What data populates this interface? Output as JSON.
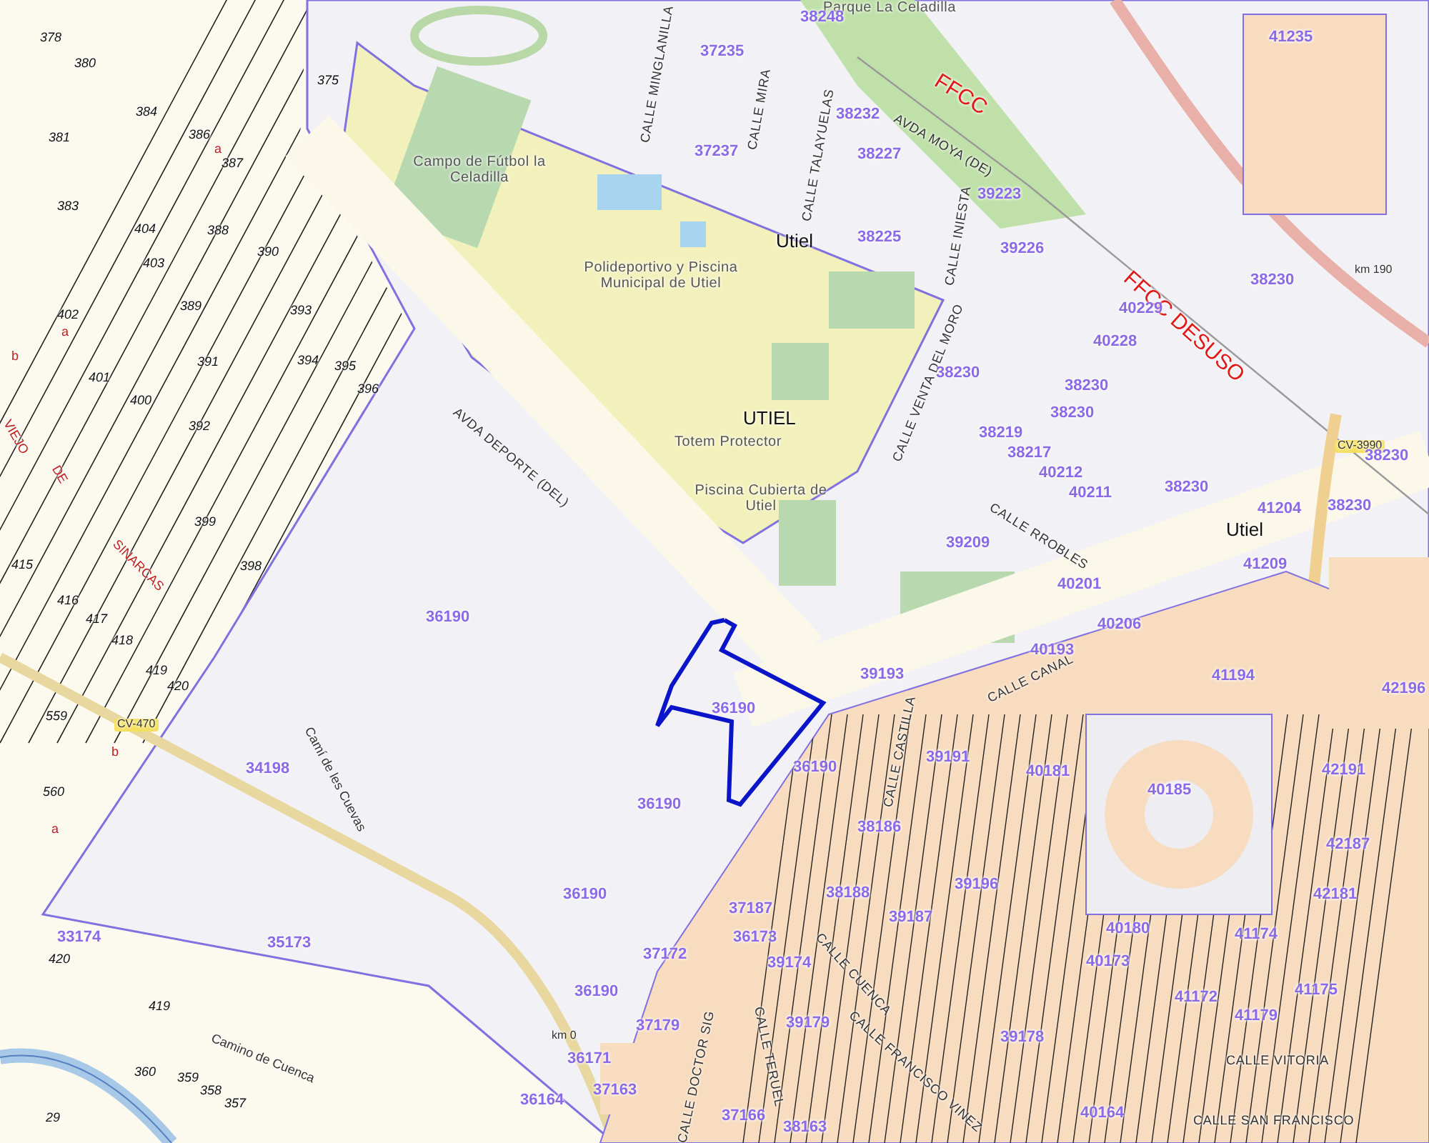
{
  "map": {
    "labels": [
      {
        "text": "Parque La Celadilla",
        "kind": "place"
      },
      {
        "text": "Campo de Fútbol la Celadilla",
        "kind": "place"
      },
      {
        "text": "Polideportivo y Piscina Municipal de Utiel",
        "kind": "place"
      },
      {
        "text": "Totem Protector",
        "kind": "place"
      },
      {
        "text": "Piscina Cubierta de Utiel",
        "kind": "place"
      },
      {
        "text": "Utiel",
        "kind": "town"
      },
      {
        "text": "UTIEL",
        "kind": "town"
      },
      {
        "text": "Utiel",
        "kind": "town"
      },
      {
        "text": "FFCC",
        "kind": "rail"
      },
      {
        "text": "FFCC DESUSO",
        "kind": "rail"
      },
      {
        "text": "CV-3990",
        "kind": "road_code"
      },
      {
        "text": "CV-470",
        "kind": "road_code"
      },
      {
        "text": "km 190",
        "kind": "km"
      },
      {
        "text": "km 0",
        "kind": "km"
      },
      {
        "text": "CALLE MINGLANILLA",
        "kind": "street"
      },
      {
        "text": "CALLE MIRA",
        "kind": "street"
      },
      {
        "text": "CALLE TALAYUELAS",
        "kind": "street"
      },
      {
        "text": "AVDA MOYA (DE)",
        "kind": "street"
      },
      {
        "text": "CALLE INIESTA",
        "kind": "street"
      },
      {
        "text": "CALLE VENTA DEL MORO",
        "kind": "street"
      },
      {
        "text": "CALLE RROBLES",
        "kind": "street"
      },
      {
        "text": "AVDA DEPORTE (DEL)",
        "kind": "street"
      },
      {
        "text": "CALLE CANAL",
        "kind": "street"
      },
      {
        "text": "CALLE CUENCA",
        "kind": "street"
      },
      {
        "text": "CALLE TERUEL",
        "kind": "street"
      },
      {
        "text": "CALLE FRANCISCO VINEZ",
        "kind": "street"
      },
      {
        "text": "CALLE VITORIA",
        "kind": "street"
      },
      {
        "text": "CALLE SAN FRANCISCO",
        "kind": "street"
      },
      {
        "text": "CALLE CASTILLA",
        "kind": "street"
      },
      {
        "text": "CALLE DOCTOR SIG",
        "kind": "street"
      },
      {
        "text": "Camí de les Cuevas",
        "kind": "path"
      },
      {
        "text": "Camino de Cuenca",
        "kind": "path"
      },
      {
        "text": "VIEJO",
        "kind": "old_road"
      },
      {
        "text": "DE",
        "kind": "old_road"
      },
      {
        "text": "SINARCAS",
        "kind": "old_road"
      },
      {
        "text": "38248",
        "kind": "parcel"
      },
      {
        "text": "37235",
        "kind": "parcel"
      },
      {
        "text": "38232",
        "kind": "parcel"
      },
      {
        "text": "37237",
        "kind": "parcel"
      },
      {
        "text": "38227",
        "kind": "parcel"
      },
      {
        "text": "39223",
        "kind": "parcel"
      },
      {
        "text": "38225",
        "kind": "parcel"
      },
      {
        "text": "39226",
        "kind": "parcel"
      },
      {
        "text": "41235",
        "kind": "parcel"
      },
      {
        "text": "38230",
        "kind": "parcel"
      },
      {
        "text": "40229",
        "kind": "parcel"
      },
      {
        "text": "40228",
        "kind": "parcel"
      },
      {
        "text": "38230",
        "kind": "parcel"
      },
      {
        "text": "38230",
        "kind": "parcel"
      },
      {
        "text": "38230",
        "kind": "parcel"
      },
      {
        "text": "38230",
        "kind": "parcel"
      },
      {
        "text": "38219",
        "kind": "parcel"
      },
      {
        "text": "38217",
        "kind": "parcel"
      },
      {
        "text": "40212",
        "kind": "parcel"
      },
      {
        "text": "40211",
        "kind": "parcel"
      },
      {
        "text": "38230",
        "kind": "parcel"
      },
      {
        "text": "41204",
        "kind": "parcel"
      },
      {
        "text": "38230",
        "kind": "parcel"
      },
      {
        "text": "39209",
        "kind": "parcel"
      },
      {
        "text": "41209",
        "kind": "parcel"
      },
      {
        "text": "36190",
        "kind": "parcel"
      },
      {
        "text": "36190",
        "kind": "parcel"
      },
      {
        "text": "36190",
        "kind": "parcel"
      },
      {
        "text": "36190",
        "kind": "parcel"
      },
      {
        "text": "36190",
        "kind": "parcel"
      },
      {
        "text": "36190",
        "kind": "parcel"
      },
      {
        "text": "34198",
        "kind": "parcel"
      },
      {
        "text": "35173",
        "kind": "parcel"
      },
      {
        "text": "33174",
        "kind": "parcel"
      },
      {
        "text": "39193",
        "kind": "parcel"
      },
      {
        "text": "40201",
        "kind": "parcel"
      },
      {
        "text": "40206",
        "kind": "parcel"
      },
      {
        "text": "40193",
        "kind": "parcel"
      },
      {
        "text": "41194",
        "kind": "parcel"
      },
      {
        "text": "42196",
        "kind": "parcel"
      },
      {
        "text": "40185",
        "kind": "parcel"
      },
      {
        "text": "42191",
        "kind": "parcel"
      },
      {
        "text": "39191",
        "kind": "parcel"
      },
      {
        "text": "40181",
        "kind": "parcel"
      },
      {
        "text": "38186",
        "kind": "parcel"
      },
      {
        "text": "37187",
        "kind": "parcel"
      },
      {
        "text": "36173",
        "kind": "parcel"
      },
      {
        "text": "39174",
        "kind": "parcel"
      },
      {
        "text": "38188",
        "kind": "parcel"
      },
      {
        "text": "39187",
        "kind": "parcel"
      },
      {
        "text": "39196",
        "kind": "parcel"
      },
      {
        "text": "37172",
        "kind": "parcel"
      },
      {
        "text": "37179",
        "kind": "parcel"
      },
      {
        "text": "39179",
        "kind": "parcel"
      },
      {
        "text": "39178",
        "kind": "parcel"
      },
      {
        "text": "36171",
        "kind": "parcel"
      },
      {
        "text": "36164",
        "kind": "parcel"
      },
      {
        "text": "37163",
        "kind": "parcel"
      },
      {
        "text": "37166",
        "kind": "parcel"
      },
      {
        "text": "38163",
        "kind": "parcel"
      },
      {
        "text": "40164",
        "kind": "parcel"
      },
      {
        "text": "41172",
        "kind": "parcel"
      },
      {
        "text": "41174",
        "kind": "parcel"
      },
      {
        "text": "41175",
        "kind": "parcel"
      },
      {
        "text": "41179",
        "kind": "parcel"
      },
      {
        "text": "42181",
        "kind": "parcel"
      },
      {
        "text": "42187",
        "kind": "parcel"
      },
      {
        "text": "40180",
        "kind": "parcel"
      },
      {
        "text": "40173",
        "kind": "parcel"
      },
      {
        "text": "375",
        "kind": "plot"
      },
      {
        "text": "378",
        "kind": "plot"
      },
      {
        "text": "380",
        "kind": "plot"
      },
      {
        "text": "381",
        "kind": "plot"
      },
      {
        "text": "383",
        "kind": "plot"
      },
      {
        "text": "384",
        "kind": "plot"
      },
      {
        "text": "386",
        "kind": "plot"
      },
      {
        "text": "387",
        "kind": "plot"
      },
      {
        "text": "388",
        "kind": "plot"
      },
      {
        "text": "390",
        "kind": "plot"
      },
      {
        "text": "389",
        "kind": "plot"
      },
      {
        "text": "393",
        "kind": "plot"
      },
      {
        "text": "394",
        "kind": "plot"
      },
      {
        "text": "395",
        "kind": "plot"
      },
      {
        "text": "396",
        "kind": "plot"
      },
      {
        "text": "402",
        "kind": "plot"
      },
      {
        "text": "401",
        "kind": "plot"
      },
      {
        "text": "400",
        "kind": "plot"
      },
      {
        "text": "391",
        "kind": "plot"
      },
      {
        "text": "392",
        "kind": "plot"
      },
      {
        "text": "399",
        "kind": "plot"
      },
      {
        "text": "398",
        "kind": "plot"
      },
      {
        "text": "404",
        "kind": "plot"
      },
      {
        "text": "403",
        "kind": "plot"
      },
      {
        "text": "415",
        "kind": "plot"
      },
      {
        "text": "416",
        "kind": "plot"
      },
      {
        "text": "417",
        "kind": "plot"
      },
      {
        "text": "418",
        "kind": "plot"
      },
      {
        "text": "419",
        "kind": "plot"
      },
      {
        "text": "420",
        "kind": "plot"
      },
      {
        "text": "559",
        "kind": "plot"
      },
      {
        "text": "560",
        "kind": "plot"
      },
      {
        "text": "420",
        "kind": "plot"
      },
      {
        "text": "419",
        "kind": "plot"
      },
      {
        "text": "360",
        "kind": "plot"
      },
      {
        "text": "359",
        "kind": "plot"
      },
      {
        "text": "358",
        "kind": "plot"
      },
      {
        "text": "357",
        "kind": "plot"
      },
      {
        "text": "29",
        "kind": "plot"
      },
      {
        "text": "a",
        "kind": "subplot"
      },
      {
        "text": "a",
        "kind": "subplot"
      },
      {
        "text": "b",
        "kind": "subplot"
      },
      {
        "text": "b",
        "kind": "subplot"
      },
      {
        "text": "a",
        "kind": "subplot"
      }
    ]
  }
}
